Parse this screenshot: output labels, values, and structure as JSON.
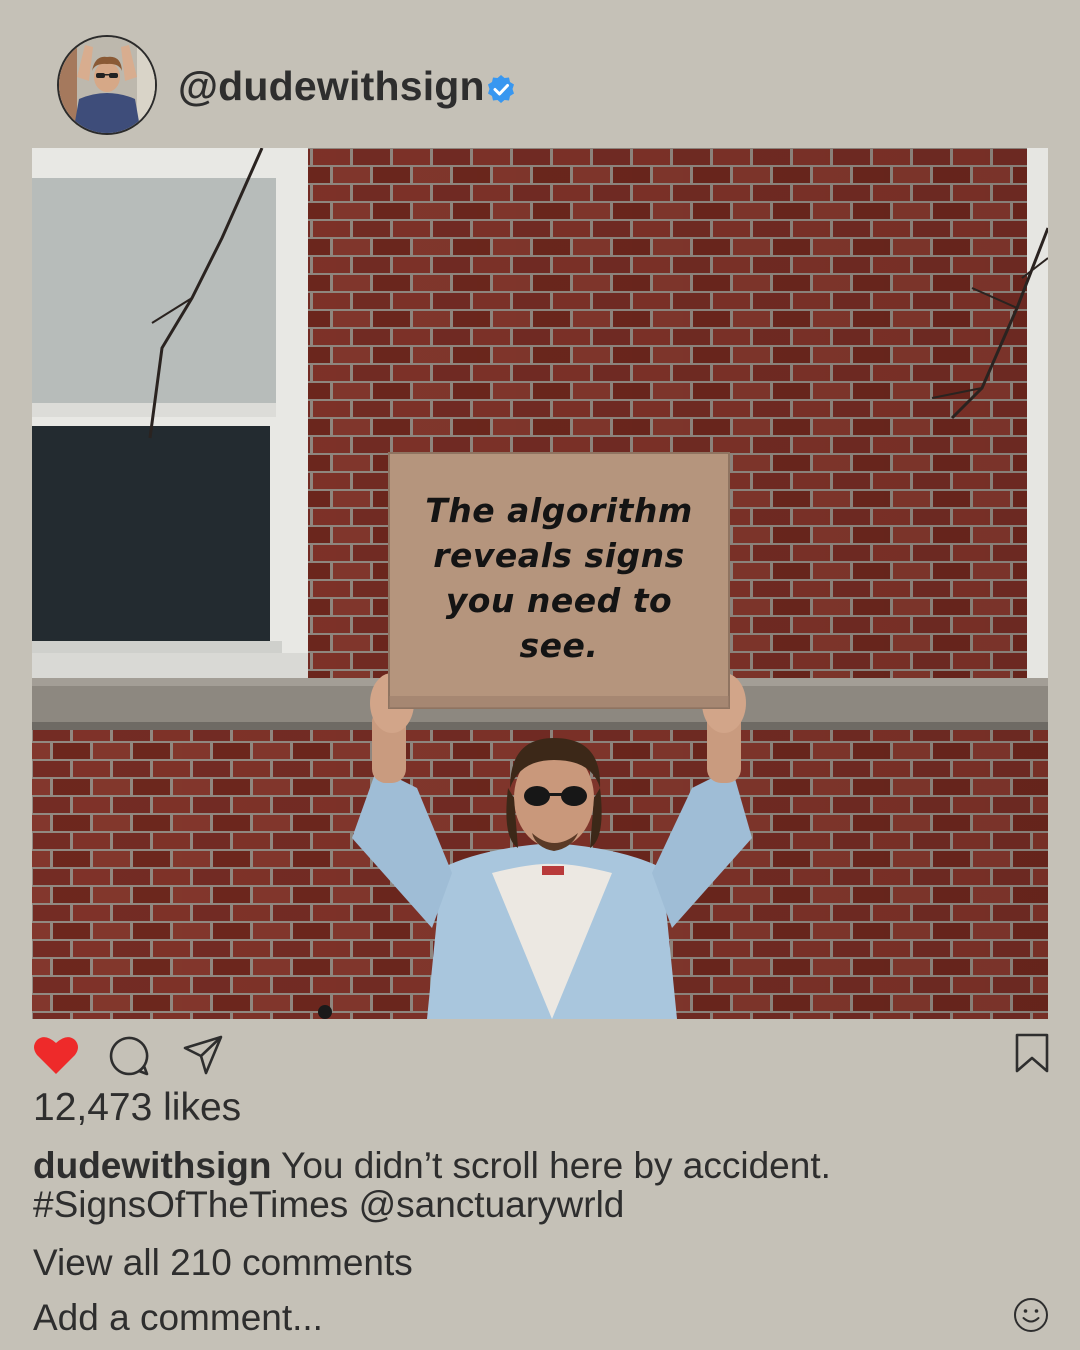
{
  "post": {
    "handle": "@dudewithsign",
    "verified": true,
    "avatar": "profile-photo",
    "photo": {
      "description": "photo",
      "sign_lines": [
        "The algorithm",
        "reveals signs",
        "you need to",
        "see."
      ]
    },
    "actions": {
      "like_icon": "heart-icon",
      "like_color": "#ee2a2a",
      "comment_icon": "comment-icon",
      "share_icon": "paper-plane-icon",
      "save_icon": "bookmark-icon"
    },
    "likes": "12,473 likes",
    "caption": {
      "username": "dudewithsign",
      "text": " You didn’t scroll here by accident.",
      "tags": "#SignsOfTheTimes @sanctuarywrld"
    },
    "view_comments": "View all 210 comments",
    "add_comment_placeholder": "Add a comment...",
    "emoji_icon": "smiley-icon"
  },
  "colors": {
    "background": "#c5c1b7",
    "verified_badge": "#3897f0",
    "text": "#2e2e2e"
  }
}
